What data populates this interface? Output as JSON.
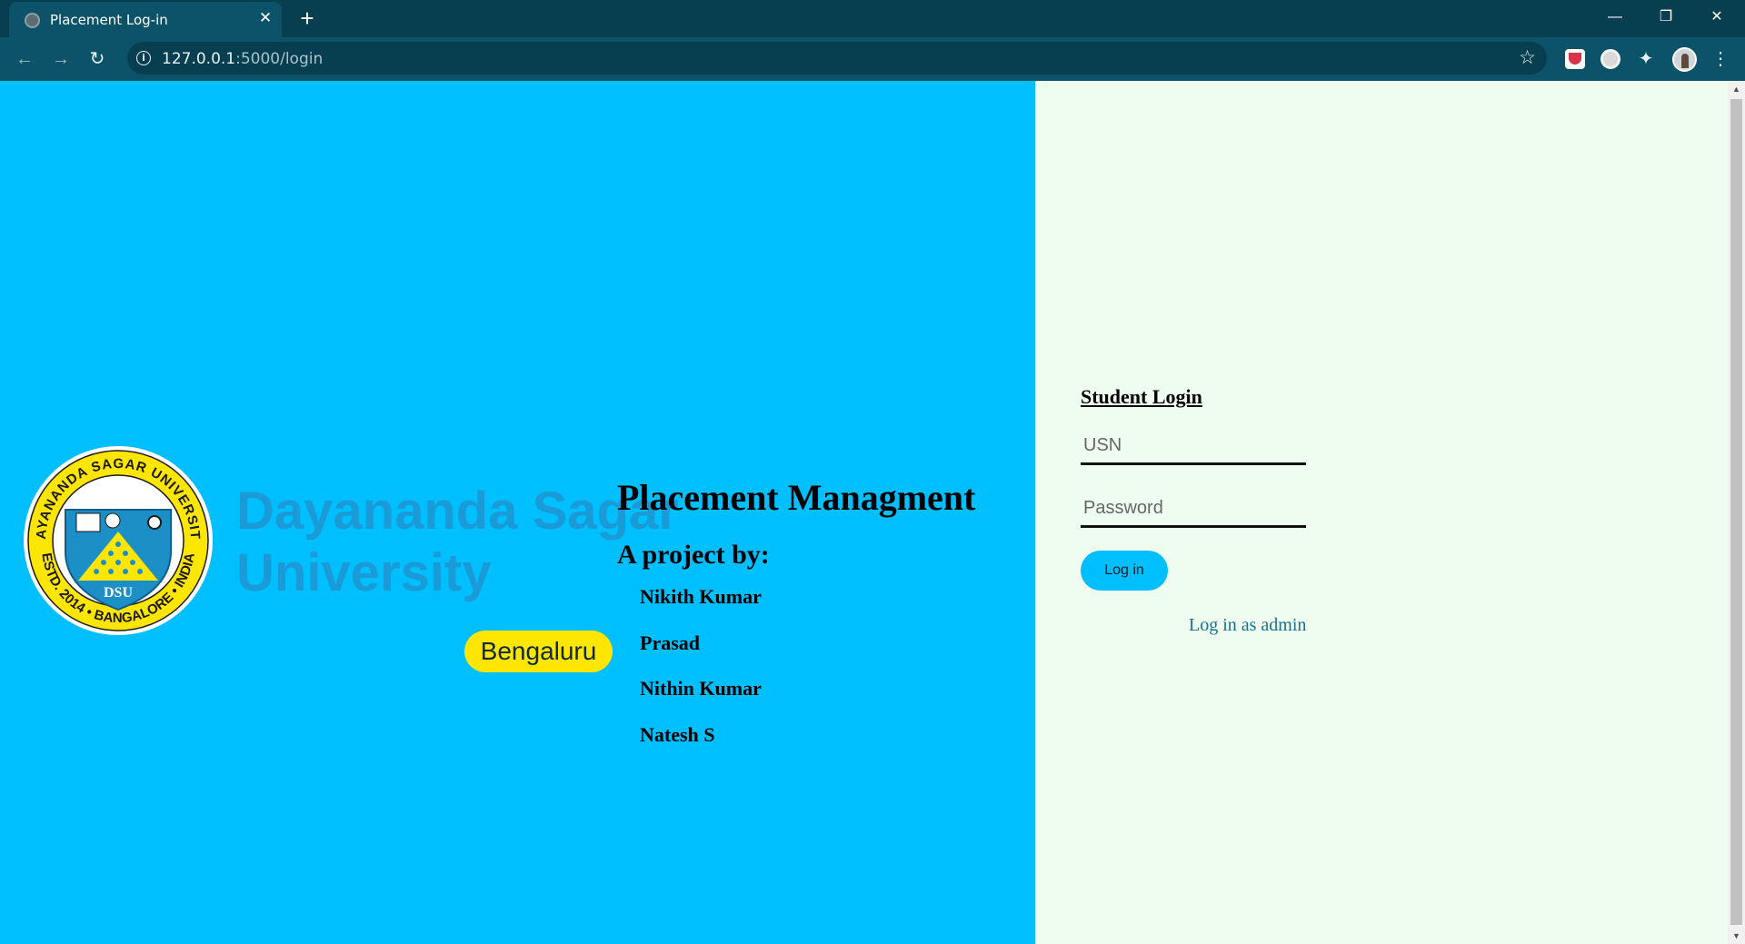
{
  "browser": {
    "tab_title": "Placement Log-in",
    "tab_close": "✕",
    "new_tab": "+",
    "url_host": "127.0.0.1",
    "url_rest": ":5000/login",
    "window_minimize": "—",
    "window_restore": "❐",
    "window_close": "✕",
    "back": "←",
    "forward": "→",
    "reload": "↻",
    "info": "i",
    "bookmark": "☆",
    "extension_icon": "✦",
    "menu": "⋮"
  },
  "branding": {
    "university_line1": "Dayananda Sagar",
    "university_line2": "University",
    "city": "Bengaluru",
    "seal_ring_top": "DAYANANDA SAGAR UNIVERSITY",
    "seal_ring_bottom": "ESTD. 2014 • BANGALORE • INDIA",
    "seal_monogram": "DSU"
  },
  "project": {
    "title": "Placement Managment",
    "by_label": "A project by:",
    "members": [
      "Nikith Kumar",
      "Prasad",
      "Nithin Kumar",
      "Natesh S"
    ]
  },
  "login": {
    "title": "Student Login",
    "usn_placeholder": "USN",
    "password_placeholder": "Password",
    "submit_label": "Log in",
    "admin_link": "Log in as admin"
  },
  "colors": {
    "left_panel": "#00bfff",
    "right_panel": "#eefdf0",
    "accent": "#00bfff",
    "link": "#1b6f8f",
    "university_blue": "#1a9ad6",
    "badge_yellow": "#ffe600"
  }
}
